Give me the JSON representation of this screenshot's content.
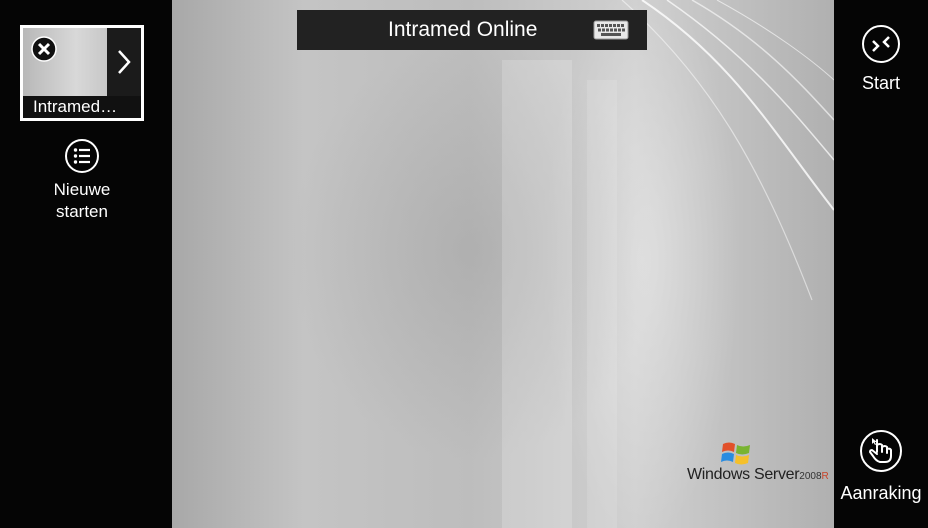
{
  "left_panel": {
    "session_thumb": {
      "caption": "Intramed…"
    },
    "new_session": {
      "label_line1": "Nieuwe",
      "label_line2": "starten"
    }
  },
  "connection_bar": {
    "title": "Intramed Online",
    "keyboard_icon": "keyboard-icon"
  },
  "desktop": {
    "brand": {
      "product": "Windows Server",
      "version": "2008",
      "edition": "R"
    }
  },
  "right_panel": {
    "start": {
      "label": "Start",
      "icon": "start-icon"
    },
    "touch": {
      "label": "Aanraking",
      "icon": "touch-pointer-icon"
    }
  },
  "colors": {
    "bar_background": "#050505",
    "topbar_background": "#222222",
    "text": "#ffffff"
  }
}
